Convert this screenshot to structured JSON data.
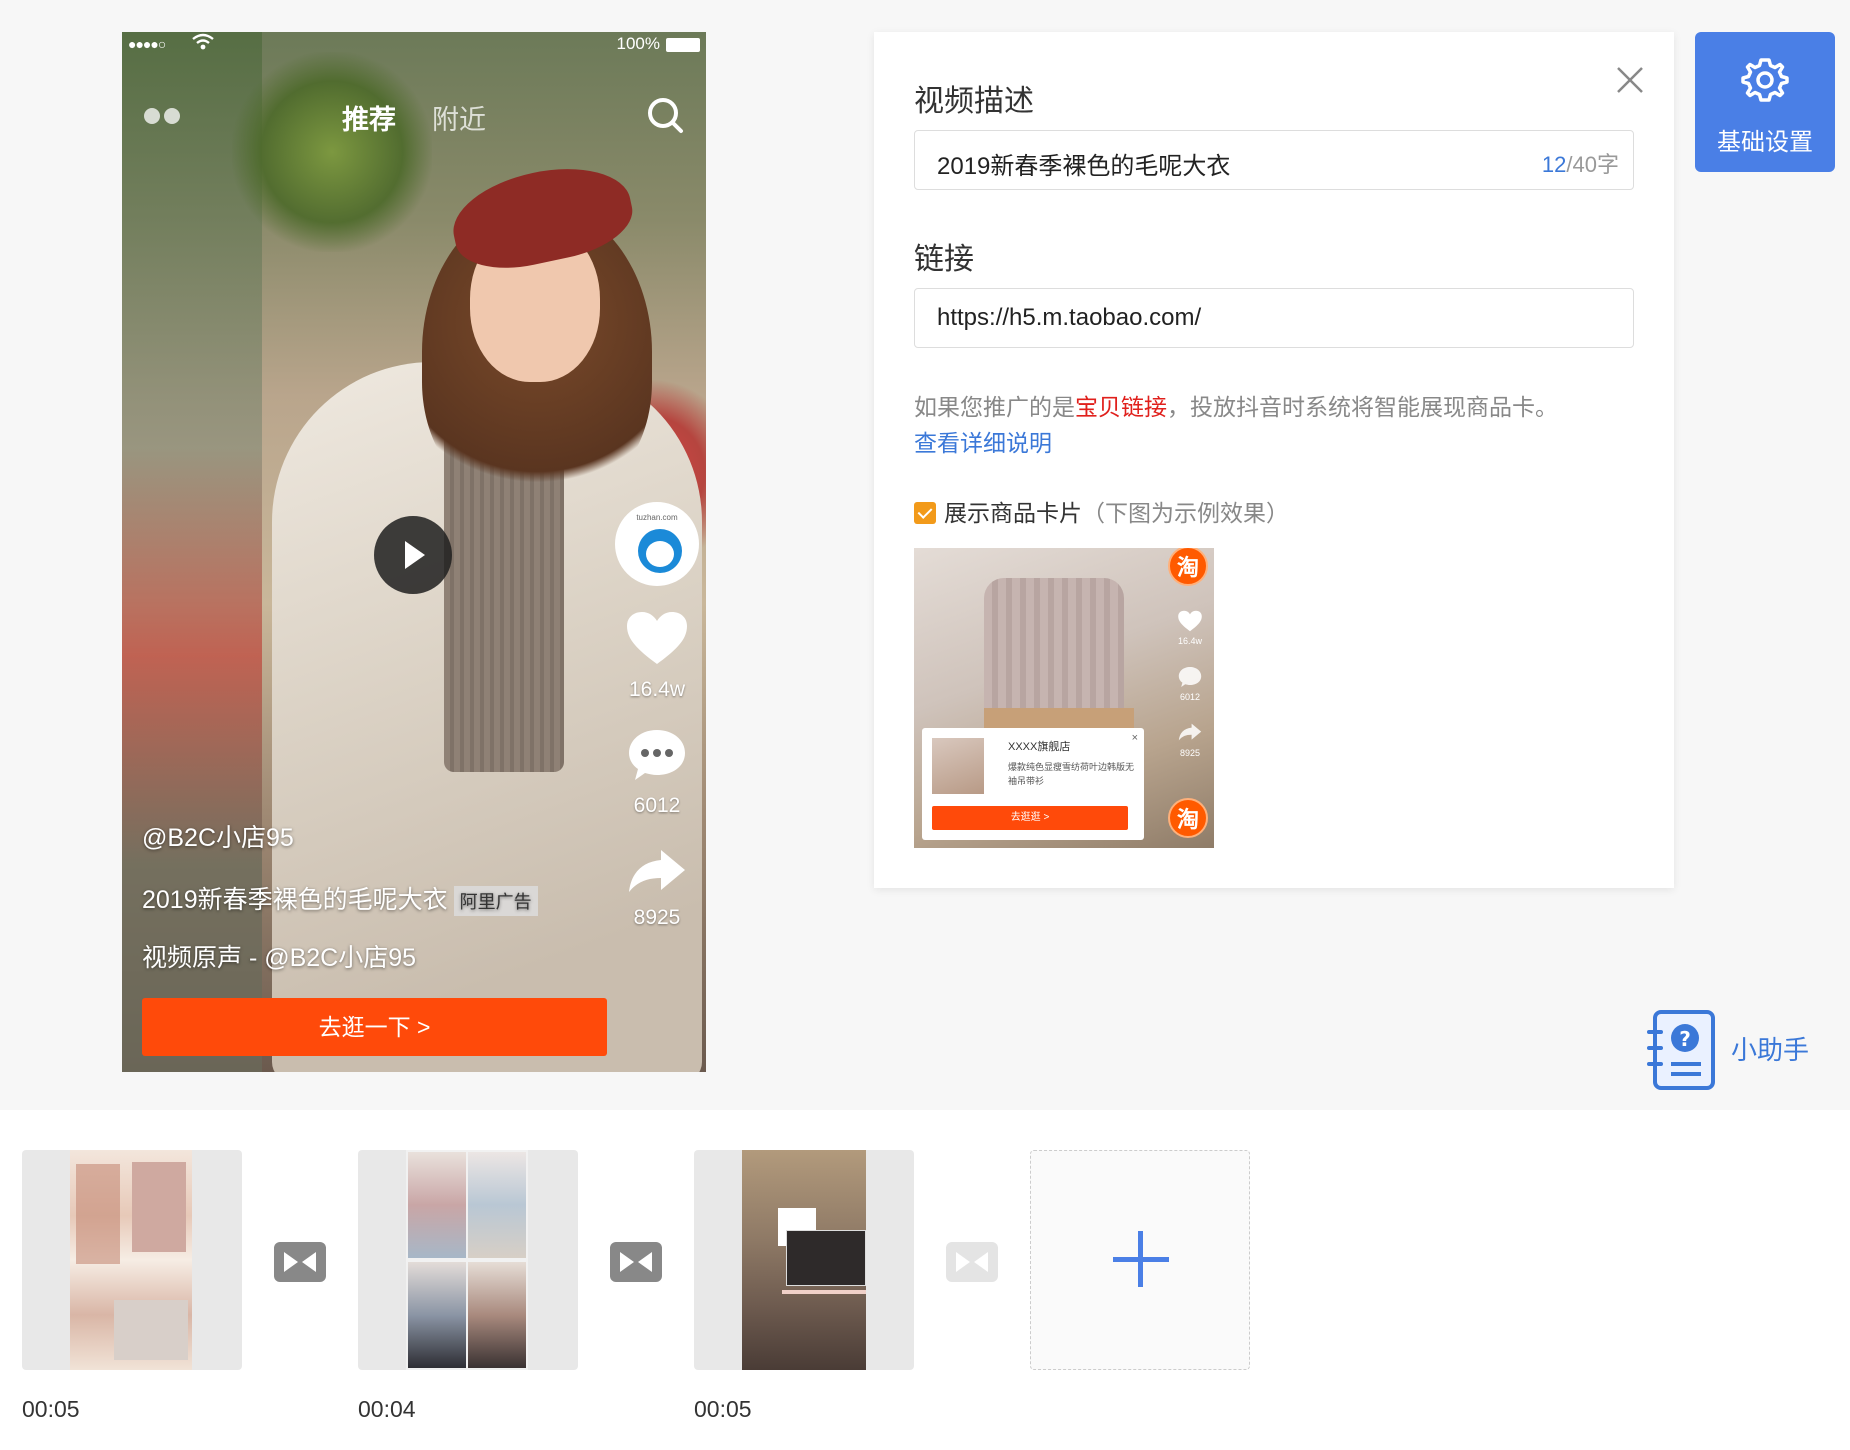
{
  "phone": {
    "status": {
      "signal": "●●●●○",
      "battery": "100%"
    },
    "tabs": {
      "recommend": "推荐",
      "nearby": "附近"
    },
    "avatar_site": "tuzhan.com",
    "likes": "16.4w",
    "comments": "6012",
    "shares": "8925",
    "username": "@B2C小店95",
    "title": "2019新春季裸色的毛呢大衣",
    "ad_tag": "阿里广告",
    "music": "视频原声 - @B2C小店95",
    "cta": "去逛一下 >"
  },
  "card": {
    "desc_label": "视频描述",
    "desc_value": "2019新春季裸色的毛呢大衣",
    "desc_count_current": "12",
    "desc_count_limit": "/40字",
    "link_label": "链接",
    "link_value": "https://h5.m.taobao.com/",
    "hint_prefix": "如果您推广的是",
    "hint_highlight": "宝贝链接",
    "hint_suffix": "，投放抖音时系统将智能展现商品卡。",
    "hint_link": "查看详细说明",
    "checkbox_label": "展示商品卡片",
    "checkbox_note": "（下图为示例效果）",
    "example": {
      "tao": "淘",
      "likes": "16.4w",
      "comments": "6012",
      "shares": "8925",
      "store": "XXXX旗舰店",
      "desc": "爆款纯色显瘦雪纺荷叶边韩版无袖吊带衫",
      "btn": "去逛逛 >",
      "close": "×"
    }
  },
  "side": {
    "settings_label": "基础设置",
    "helper_label": "小助手"
  },
  "timeline": {
    "clips": [
      {
        "time": "00:05"
      },
      {
        "time": "00:04"
      },
      {
        "time": "00:05"
      }
    ]
  },
  "colors": {
    "accent": "#4a7fe6",
    "cta": "#ff4a0a",
    "highlight": "#e0201c",
    "checkbox": "#f29a1a"
  }
}
